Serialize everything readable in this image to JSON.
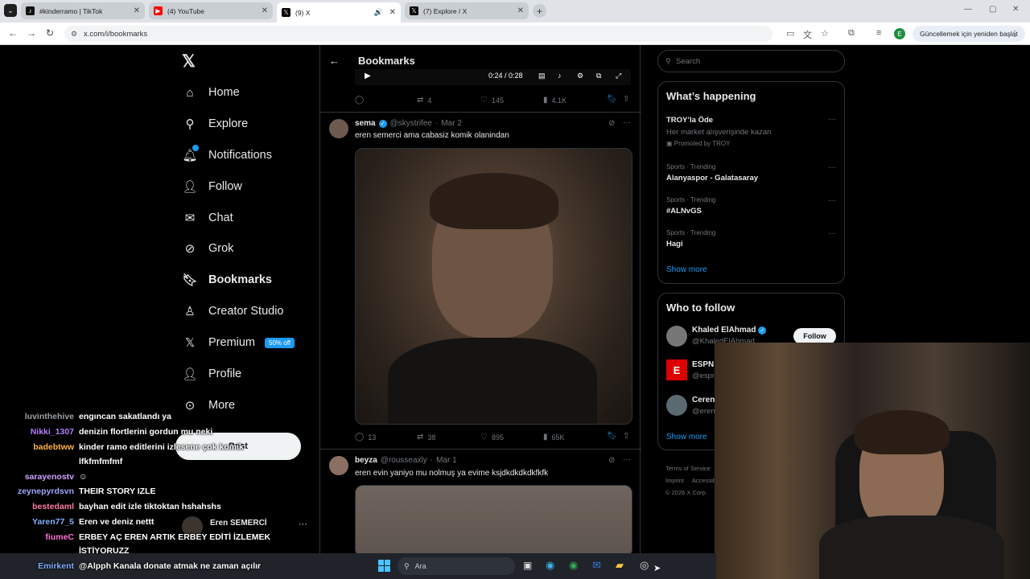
{
  "browser": {
    "tabs": [
      {
        "title": "#kinderramo | TikTok",
        "icon": "tiktok-icon"
      },
      {
        "title": "(4) YouTube",
        "icon": "youtube-icon"
      },
      {
        "title": "(9) X",
        "icon": "x-icon"
      },
      {
        "title": "(7) Explore / X",
        "icon": "x-icon"
      }
    ],
    "url": "x.com/i/bookmarks",
    "update_label": "Güncellemek için yeniden başlat",
    "profile_initial": "E"
  },
  "sidebar": {
    "items": [
      {
        "label": "Home",
        "icon": "home-icon"
      },
      {
        "label": "Explore",
        "icon": "search-icon"
      },
      {
        "label": "Notifications",
        "icon": "bell-icon"
      },
      {
        "label": "Follow",
        "icon": "person-add-icon"
      },
      {
        "label": "Chat",
        "icon": "mail-icon"
      },
      {
        "label": "Grok",
        "icon": "grok-icon"
      },
      {
        "label": "Bookmarks",
        "icon": "bookmark-icon"
      },
      {
        "label": "Creator Studio",
        "icon": "creator-icon"
      },
      {
        "label": "Premium",
        "icon": "x-icon"
      },
      {
        "label": "Profile",
        "icon": "person-icon"
      },
      {
        "label": "More",
        "icon": "more-icon"
      }
    ],
    "premium_badge": "50% off",
    "post_button": "Post",
    "account_name": "Eren SEMERCİ"
  },
  "feed": {
    "title": "Bookmarks",
    "video_time": "0:24 / 0:28",
    "tweets": [
      {
        "replies": "",
        "retweets": "4",
        "likes": "145",
        "views": "4.1K"
      },
      {
        "name": "sema",
        "handle": "@skystrifee",
        "date": "Mar 2",
        "text": "eren semerci ama cabasiz komik olanindan",
        "replies": "13",
        "retweets": "38",
        "likes": "895",
        "views": "65K"
      },
      {
        "name": "beyza",
        "handle": "@rousseaxly",
        "date": "Mar 1",
        "text": "eren evin yaniyo mu nolmuş ya evime ksjdkdkdkdkfkfk"
      }
    ]
  },
  "right": {
    "search_placeholder": "Search",
    "happening_title": "What’s happening",
    "trends": [
      {
        "category": "",
        "name": "TROY’la Öde",
        "sub": "Her market alışverişinde kazan",
        "promo": "Promoted by TROY"
      },
      {
        "category": "Sports · Trending",
        "name": "Alanyaspor - Galatasaray"
      },
      {
        "category": "Sports · Trending",
        "name": "#ALNvGS"
      },
      {
        "category": "Sports · Trending",
        "name": "Hagi"
      }
    ],
    "show_more": "Show more",
    "who_title": "Who to follow",
    "follow": [
      {
        "name": "Khaled ElAhmad",
        "handle": "@KhaledElAhmad"
      },
      {
        "name": "ESPN",
        "handle": "@espn"
      },
      {
        "name": "Ceren",
        "handle": "@eren"
      }
    ],
    "follow_button": "Follow",
    "footer": [
      "Terms of Service",
      "Imprint",
      "Accessibility",
      "© 2026 X Corp."
    ]
  },
  "chat": [
    {
      "user": "luvinthehive",
      "color": "#9aa0a6",
      "msg": "engıncan sakatlandı ya"
    },
    {
      "user": "Nikki_1307",
      "color": "#b47cff",
      "msg": "denizin flortlerini gordun mu neki"
    },
    {
      "user": "badebtww",
      "color": "#ffb347",
      "msg": "kinder ramo editlerini izlesene çok komik"
    },
    {
      "user": "",
      "color": "#ffffff",
      "msg": "lfkfmfmfmf"
    },
    {
      "user": "sarayenostv",
      "color": "#d0a0ff",
      "msg": ""
    },
    {
      "user": "zeynepyrdsvn",
      "color": "#9fa8ff",
      "msg": "THEIR STORY IZLE"
    },
    {
      "user": "bestedaml",
      "color": "#ff7aa8",
      "msg": "bayhan edit izle tiktoktan hshahshs"
    },
    {
      "user": "Yaren77_5",
      "color": "#7fb2ff",
      "msg": "Eren ve deniz nettt"
    },
    {
      "user": "fiumeC",
      "color": "#ff6fd8",
      "msg": "ERBEY AÇ EREN ARTIK ERBEY EDİTİ İZLEMEK"
    },
    {
      "user": "",
      "color": "#ffffff",
      "msg": "İSTİYORUZZ"
    },
    {
      "user": "Emirkent",
      "color": "#7fb2ff",
      "msg": "@Alpph Kanala donate atmak ne zaman açılır"
    }
  ],
  "taskbar": {
    "search_label": "Ara"
  }
}
